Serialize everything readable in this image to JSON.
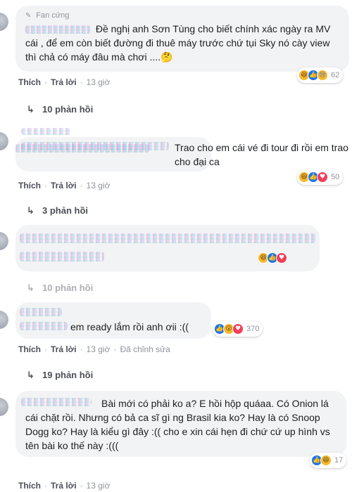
{
  "comments": [
    {
      "badge": "Fan cứng",
      "badge_icon": "fan-badge-icon",
      "author_blurred": true,
      "text": "Đề nghị anh Sơn Tùng cho biết chính xác ngày ra MV cái , để em còn biết đường đi thuê máy trước chứ tụi Sky nó cày view thì chả có máy đâu mà chơi ....🤔",
      "reactions": [
        "haha",
        "like",
        "sad"
      ],
      "reaction_count": "62",
      "actions": [
        "Thích",
        "Trả lời"
      ],
      "time": "13 giờ",
      "replies": "10 phản hồi"
    },
    {
      "author_blurred": true,
      "text": "Trao cho em cái vé đi tour đi rồi em trao cho đại ca",
      "reactions": [
        "haha",
        "like",
        "love"
      ],
      "reaction_count": "50",
      "actions": [
        "Thích",
        "Trả lời"
      ],
      "time": "13 giờ",
      "replies": "3 phản hồi"
    },
    {
      "author_blurred": true,
      "text_blurred": true,
      "reactions": [
        "haha",
        "like",
        "love"
      ],
      "reaction_count": "",
      "replies": "10 phản hồi"
    },
    {
      "author_blurred": true,
      "text": "em ready lắm rồi anh ơii :((",
      "reactions": [
        "like",
        "wow",
        "love"
      ],
      "reaction_count": "370",
      "actions": [
        "Thích",
        "Trả lời"
      ],
      "time": "13 giờ",
      "edited": "Đã chỉnh sửa",
      "replies": "19 phản hồi"
    },
    {
      "author_blurred": true,
      "text": "Bài mới có phải ko a? E hồi hộp quáaa. Có Onion lá cái chặt rồi. Nhưng có bả ca sĩ gì ng Brasil kia ko? Hay là có Snoop Dogg ko? Hay là kiểu gì đây :(( cho e xin cái hẹn đi chứ cứ up hình vs tên bài ko thế này :(((",
      "reactions": [
        "like",
        "haha"
      ],
      "reaction_count": "17",
      "actions": [
        "Thích",
        "Trả lời"
      ],
      "time": "13 giờ"
    }
  ],
  "colors": {
    "bubble": "#f2f3f5",
    "link": "#4b4f56",
    "meta": "#90949c",
    "like": "#1877f2",
    "love": "#f33e58",
    "haha": "#f7b928"
  }
}
